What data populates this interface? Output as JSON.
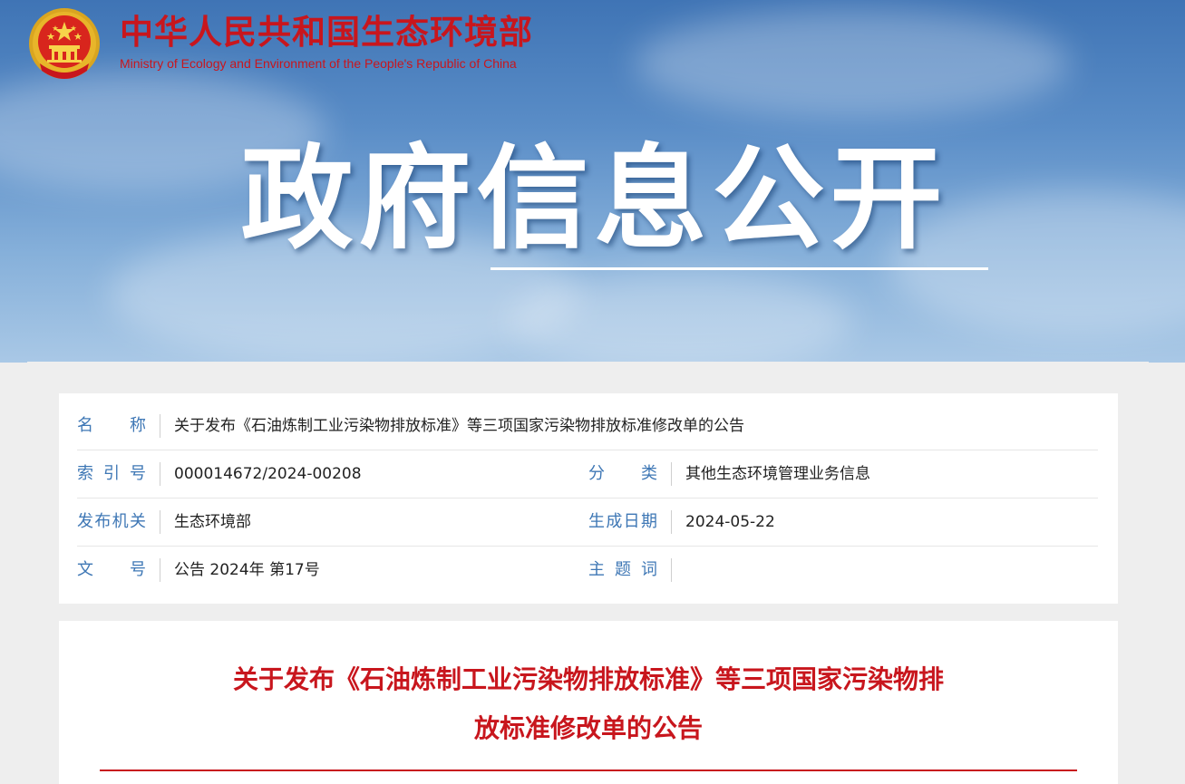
{
  "header": {
    "site_name_cn": "中华人民共和国生态环境部",
    "site_name_en": "Ministry of Ecology and Environment of the People's Republic of China",
    "emblem_icon": "national-emblem-icon",
    "brand_color": "#c8161d"
  },
  "hero": {
    "title": "政府信息公开"
  },
  "meta": {
    "name": {
      "label": "名称",
      "value": "关于发布《石油炼制工业污染物排放标准》等三项国家污染物排放标准修改单的公告"
    },
    "index_no": {
      "label": "索引号",
      "value": "000014672/2024-00208"
    },
    "category": {
      "label": "分类",
      "value": "其他生态环境管理业务信息"
    },
    "issuer": {
      "label": "发布机关",
      "value": "生态环境部"
    },
    "date": {
      "label": "生成日期",
      "value": "2024-05-22"
    },
    "doc_no": {
      "label": "文号",
      "value": "公告 2024年 第17号"
    },
    "keywords": {
      "label": "主题词",
      "value": ""
    },
    "label_color": "#3e77b5"
  },
  "article": {
    "title_line1": "关于发布《石油炼制工业污染物排放标准》等三项国家污染物排",
    "title_line2": "放标准修改单的公告"
  }
}
